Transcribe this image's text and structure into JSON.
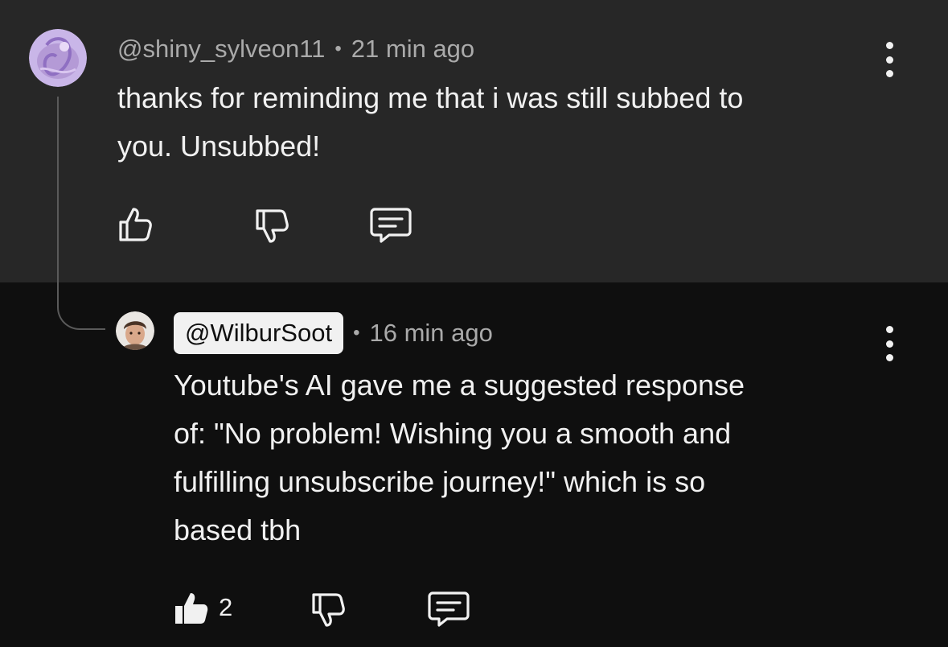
{
  "comment": {
    "author": "@shiny_sylveon11",
    "separator": "•",
    "time": "21 min ago",
    "text_line1": "thanks for reminding me that i was still subbed to",
    "text_line2": "you. Unsubbed!",
    "icons": {
      "avatar": "sylveon-avatar",
      "more": "kebab-menu-icon",
      "like": "thumbs-up-outline-icon",
      "dislike": "thumbs-down-outline-icon",
      "reply": "comment-bubble-icon"
    }
  },
  "reply": {
    "author": "@WilburSoot",
    "separator": "•",
    "time": "16 min ago",
    "text_line1": "Youtube's AI gave me a suggested response",
    "text_line2": "of: \"No problem! Wishing you a smooth and",
    "text_line3": "fulfilling unsubscribe journey!\" which is so",
    "text_line4": "based tbh",
    "like_count": "2",
    "icons": {
      "avatar": "creator-avatar",
      "more": "kebab-menu-icon",
      "like": "thumbs-up-filled-icon",
      "dislike": "thumbs-down-outline-icon",
      "reply": "comment-bubble-icon"
    }
  },
  "colors": {
    "parent_bg": "#272727",
    "reply_bg": "#0f0f0f",
    "text": "#f1f1f1",
    "meta": "#aaaaaa",
    "pill_bg": "#f1f1f1"
  }
}
